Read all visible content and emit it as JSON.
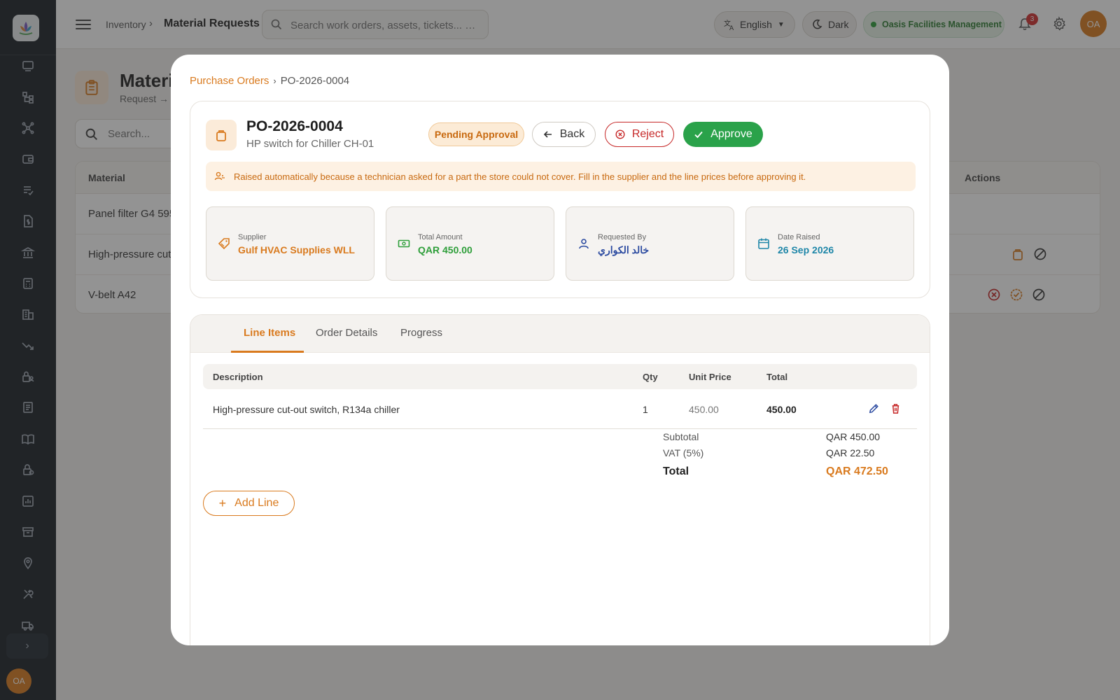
{
  "header": {
    "breadcrumb_parent": "Inventory",
    "breadcrumb_current": "Material Requests",
    "search_placeholder": "Search work orders, assets, tickets... …",
    "language": "English",
    "theme_toggle": "Dark",
    "organization": "Oasis Facilities Management",
    "notification_count": "3",
    "user_initials": "OA"
  },
  "sidebar": {
    "user_initials": "OA",
    "icons": [
      "dashboard-icon",
      "hierarchy-icon",
      "network-icon",
      "wallet-icon",
      "checklist-icon",
      "invoice-icon",
      "bank-icon",
      "calculator-icon",
      "building-icon",
      "trend-icon",
      "lock-user-icon",
      "ledger-icon",
      "book-icon",
      "lock-icon",
      "report-icon",
      "archive-icon",
      "location-icon",
      "tools-icon",
      "truck-icon"
    ]
  },
  "background": {
    "page_title": "Materi",
    "page_sub": "Request →",
    "search_placeholder": "Search...",
    "col_material": "Material",
    "col_actions": "Actions",
    "rows": [
      "Panel filter G4 595",
      "High-pressure cut",
      "V-belt A42"
    ]
  },
  "modal": {
    "breadcrumb_parent": "Purchase Orders",
    "breadcrumb_current": "PO-2026-0004",
    "po_number": "PO-2026-0004",
    "po_subtitle": "HP switch for Chiller CH-01",
    "status": "Pending Approval",
    "back_label": "Back",
    "reject_label": "Reject",
    "approve_label": "Approve",
    "notice": "Raised automatically because a technician asked for a part the store could not cover. Fill in the supplier and the line prices before approving it.",
    "stats": [
      {
        "label": "Supplier",
        "value": "Gulf HVAC Supplies WLL",
        "color": "#d97a1e"
      },
      {
        "label": "Total Amount",
        "value": "QAR 450.00",
        "color": "#2e9e3a"
      },
      {
        "label": "Requested By",
        "value": "خالد الكواري",
        "color": "#2b4aa0"
      },
      {
        "label": "Date Raised",
        "value": "26 Sep 2026",
        "color": "#1e86a8"
      }
    ],
    "tabs": [
      "Line Items",
      "Order Details",
      "Progress"
    ],
    "active_tab": "Line Items",
    "table": {
      "headers": {
        "description": "Description",
        "qty": "Qty",
        "unit_price": "Unit Price",
        "total": "Total"
      },
      "rows": [
        {
          "description": "High-pressure cut-out switch, R134a chiller",
          "qty": "1",
          "unit_price": "450.00",
          "total": "450.00"
        }
      ]
    },
    "summary": {
      "subtotal_label": "Subtotal",
      "subtotal": "QAR 450.00",
      "vat_label": "VAT (5%)",
      "vat": "QAR 22.50",
      "total_label": "Total",
      "total": "QAR 472.50"
    },
    "add_line_label": "Add Line"
  }
}
